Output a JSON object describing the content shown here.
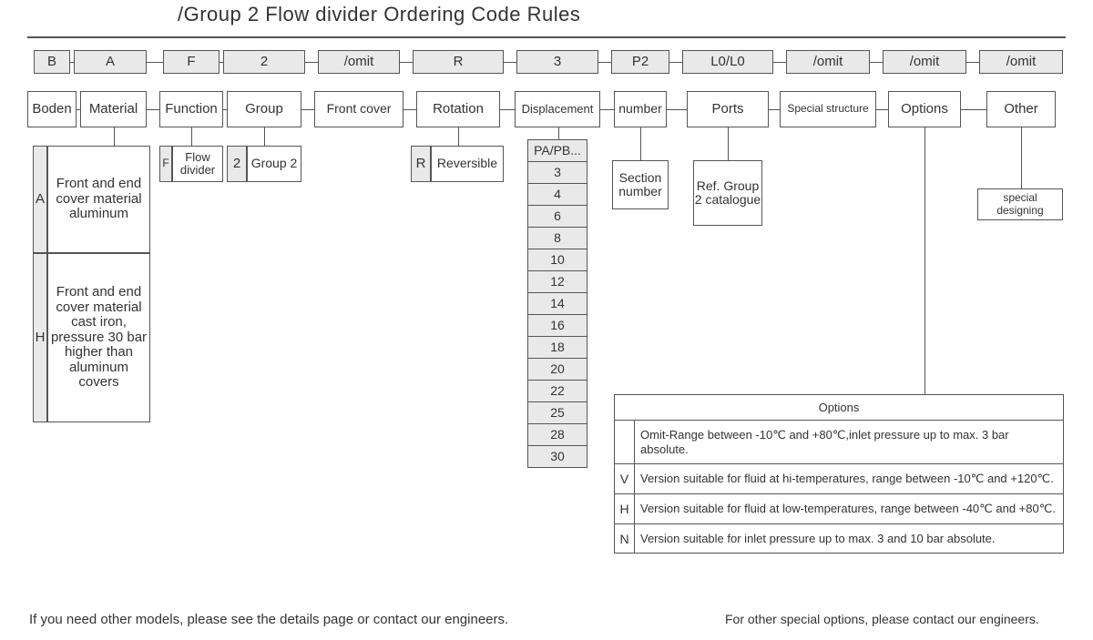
{
  "title": "/Group 2 Flow divider Ordering Code Rules",
  "row_code": {
    "b": "B",
    "a": "A",
    "f": "F",
    "two": "2",
    "omit1": "/omit",
    "r": "R",
    "three": "3",
    "p2": "P2",
    "l0": "L0/L0",
    "omit2": "/omit",
    "omit3": "/omit",
    "omit4": "/omit"
  },
  "row_label": {
    "boden": "Boden",
    "material": "Material",
    "function": "Function",
    "group": "Group",
    "frontcover": "Front cover",
    "rotation": "Rotation",
    "displacement": "Displacement",
    "number": "number",
    "ports": "Ports",
    "special": "Special structure",
    "options": "Options",
    "other": "Other"
  },
  "material": {
    "a_code": "A",
    "a_desc": "Front and end cover material aluminum",
    "h_code": "H",
    "h_desc": "Front and end cover material cast iron, pressure 30 bar higher than aluminum covers"
  },
  "function_def": {
    "code": "F",
    "desc": "Flow divider"
  },
  "group_def": {
    "code": "2",
    "desc": "Group 2"
  },
  "rotation_def": {
    "code": "R",
    "desc": "Reversible"
  },
  "displacement_vals": [
    "PA/PB...",
    "3",
    "4",
    "6",
    "8",
    "10",
    "12",
    "14",
    "16",
    "18",
    "20",
    "22",
    "25",
    "28",
    "30"
  ],
  "number_def": "Section number",
  "ports_def": "Ref. Group 2 catalogue",
  "other_def": "special designing",
  "options_table": {
    "header": "Options",
    "rows": [
      {
        "code": "",
        "desc": "Omit-Range between -10℃ and +80℃,inlet pressure up to max. 3 bar absolute."
      },
      {
        "code": "V",
        "desc": "Version suitable for fluid at hi-temperatures, range between -10℃ and +120℃."
      },
      {
        "code": "H",
        "desc": "Version suitable for fluid at low-temperatures, range between -40℃ and +80℃."
      },
      {
        "code": "N",
        "desc": "Version suitable for inlet pressure up to max. 3 and 10 bar absolute."
      }
    ],
    "footer": "For other special options, please contact our engineers."
  },
  "footer": "If you need other models, please see the details page or contact our engineers."
}
